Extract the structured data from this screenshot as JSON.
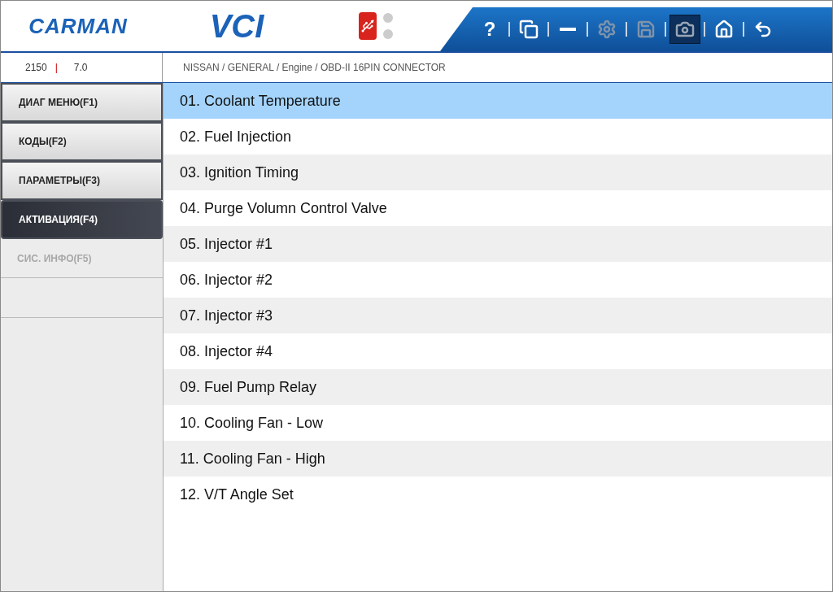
{
  "header": {
    "logo": "CARMAN",
    "product": "VCI",
    "leds": [
      {
        "on": false
      },
      {
        "on": false
      }
    ],
    "toolbar": [
      {
        "kind": "help",
        "label": "?",
        "disabled": false,
        "selected": false
      },
      {
        "kind": "windows",
        "disabled": false,
        "selected": false
      },
      {
        "kind": "minimize",
        "disabled": false,
        "selected": false
      },
      {
        "kind": "settings",
        "disabled": true,
        "selected": false
      },
      {
        "kind": "save",
        "disabled": true,
        "selected": false
      },
      {
        "kind": "camera",
        "disabled": false,
        "selected": true
      },
      {
        "kind": "home",
        "disabled": false,
        "selected": false
      },
      {
        "kind": "back",
        "disabled": false,
        "selected": false
      }
    ]
  },
  "info": {
    "code": "2150",
    "separator": "|",
    "version": "7.0",
    "breadcrumb": "NISSAN / GENERAL / Engine / OBD-II 16PIN CONNECTOR"
  },
  "sidebar": {
    "items": [
      {
        "label": "ДИАГ МЕНЮ(F1)",
        "selected": false,
        "disabled": false
      },
      {
        "label": "КОДЫ(F2)",
        "selected": false,
        "disabled": false
      },
      {
        "label": "ПАРАМЕТРЫ(F3)",
        "selected": false,
        "disabled": false
      },
      {
        "label": "АКТИВАЦИЯ(F4)",
        "selected": true,
        "disabled": false
      },
      {
        "label": "СИС. ИНФО(F5)",
        "selected": false,
        "disabled": true
      }
    ]
  },
  "list": {
    "rows": [
      {
        "label": "01. Coolant Temperature",
        "selected": true
      },
      {
        "label": "02. Fuel Injection",
        "selected": false
      },
      {
        "label": "03. Ignition Timing",
        "selected": false
      },
      {
        "label": "04. Purge Volumn Control Valve",
        "selected": false
      },
      {
        "label": "05. Injector #1",
        "selected": false
      },
      {
        "label": "06. Injector #2",
        "selected": false
      },
      {
        "label": "07. Injector #3",
        "selected": false
      },
      {
        "label": "08. Injector #4",
        "selected": false
      },
      {
        "label": "09. Fuel Pump Relay",
        "selected": false
      },
      {
        "label": "10. Cooling Fan - Low",
        "selected": false
      },
      {
        "label": "11. Cooling Fan - High",
        "selected": false
      },
      {
        "label": "12. V/T Angle Set",
        "selected": false
      }
    ]
  }
}
